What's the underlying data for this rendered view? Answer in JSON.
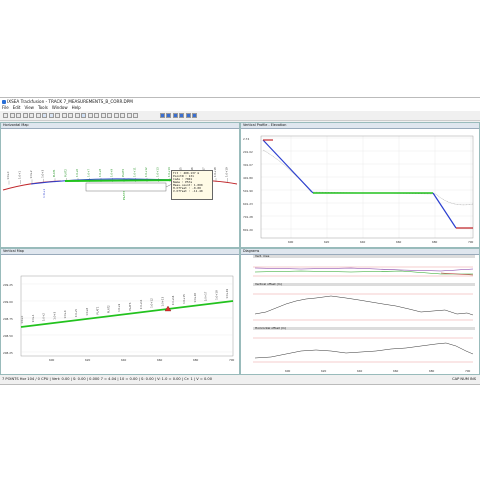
{
  "window": {
    "title": "IXSEA Trackfusion - TRACK 7_MEASUREMENTS_B_CORR.DPM",
    "menu": [
      "File",
      "Edit",
      "View",
      "Tools",
      "Window",
      "Help"
    ]
  },
  "panes": {
    "horizontal": {
      "title": "Horizontal Map",
      "labels": [
        "1:0+0",
        "1:0+1",
        "1:0+2",
        "1:0+3",
        "PLAT1",
        "PLAT2",
        "1:0+6",
        "1:0+7",
        "1:0+8",
        "1:0+9",
        "PLAT3",
        "1:0+11",
        "1:0+12",
        "1:0+13",
        "1:0+14",
        "1:0+15",
        "1:0+16",
        "1:0+17",
        "1:0+18",
        "1:0+19"
      ],
      "tooltip": [
        "Tit       : 400.137 m",
        "PointN    : 131",
        "Code      : 7001",
        "Name      : P57a",
        "Meas.count: 1.000",
        "H.Offset  : -0.00",
        "V.Offset  : -11.40"
      ]
    },
    "vertical_profile": {
      "title": "Vertical Profile - Elevation",
      "y_ticks": [
        "2.74",
        "201.02",
        "301.07",
        "401.80",
        "501.90",
        "601.23",
        "701.28",
        "801.20"
      ],
      "x_ticks": [
        "600",
        "620",
        "640",
        "660",
        "680",
        "700"
      ]
    },
    "vertical_map": {
      "title": "Vertical Map",
      "labels": [
        "1:0+0",
        "1:0+1",
        "1:0+2",
        "1:0+3",
        "1:0+4",
        "1:0+5",
        "1:0+6",
        "PLAT1",
        "PLAT2",
        "1:0+9",
        "PLAT3",
        "1:0+11",
        "1:0+12",
        "1:0+13",
        "1:0+14",
        "1:0+15",
        "1:0+16",
        "1:0+17",
        "1:0+18",
        "1:0+19"
      ],
      "y_ticks": [
        "209.25",
        "209.00",
        "208.75",
        "208.50",
        "208.25"
      ],
      "x_ticks": [
        "600",
        "620",
        "640",
        "660",
        "680",
        "700"
      ]
    },
    "diagrams": {
      "title": "Diagrams",
      "sections": [
        "Vert. mes",
        "Vertical offset (m)",
        "Horizontal offset (m)"
      ],
      "x_ticks": [
        "600",
        "620",
        "640",
        "660",
        "680",
        "700"
      ]
    }
  },
  "status": {
    "left": "7 POINTS Hor 104 / 0 CPU | Vert: 0.00 | S: 0.00 | 0.000  7 = 4.04 | 10 = 0.00 | S: 0.00 | V: 1.0 = 0.00 | Cr: 1 | V = 0.00",
    "right": "CAP  NUM  INS"
  },
  "colors": {
    "alignment_red": "#c0262b",
    "alignment_blue": "#2b3fd0",
    "measurement_green": "#22c21e",
    "pane_header": "#dfe6ee"
  }
}
